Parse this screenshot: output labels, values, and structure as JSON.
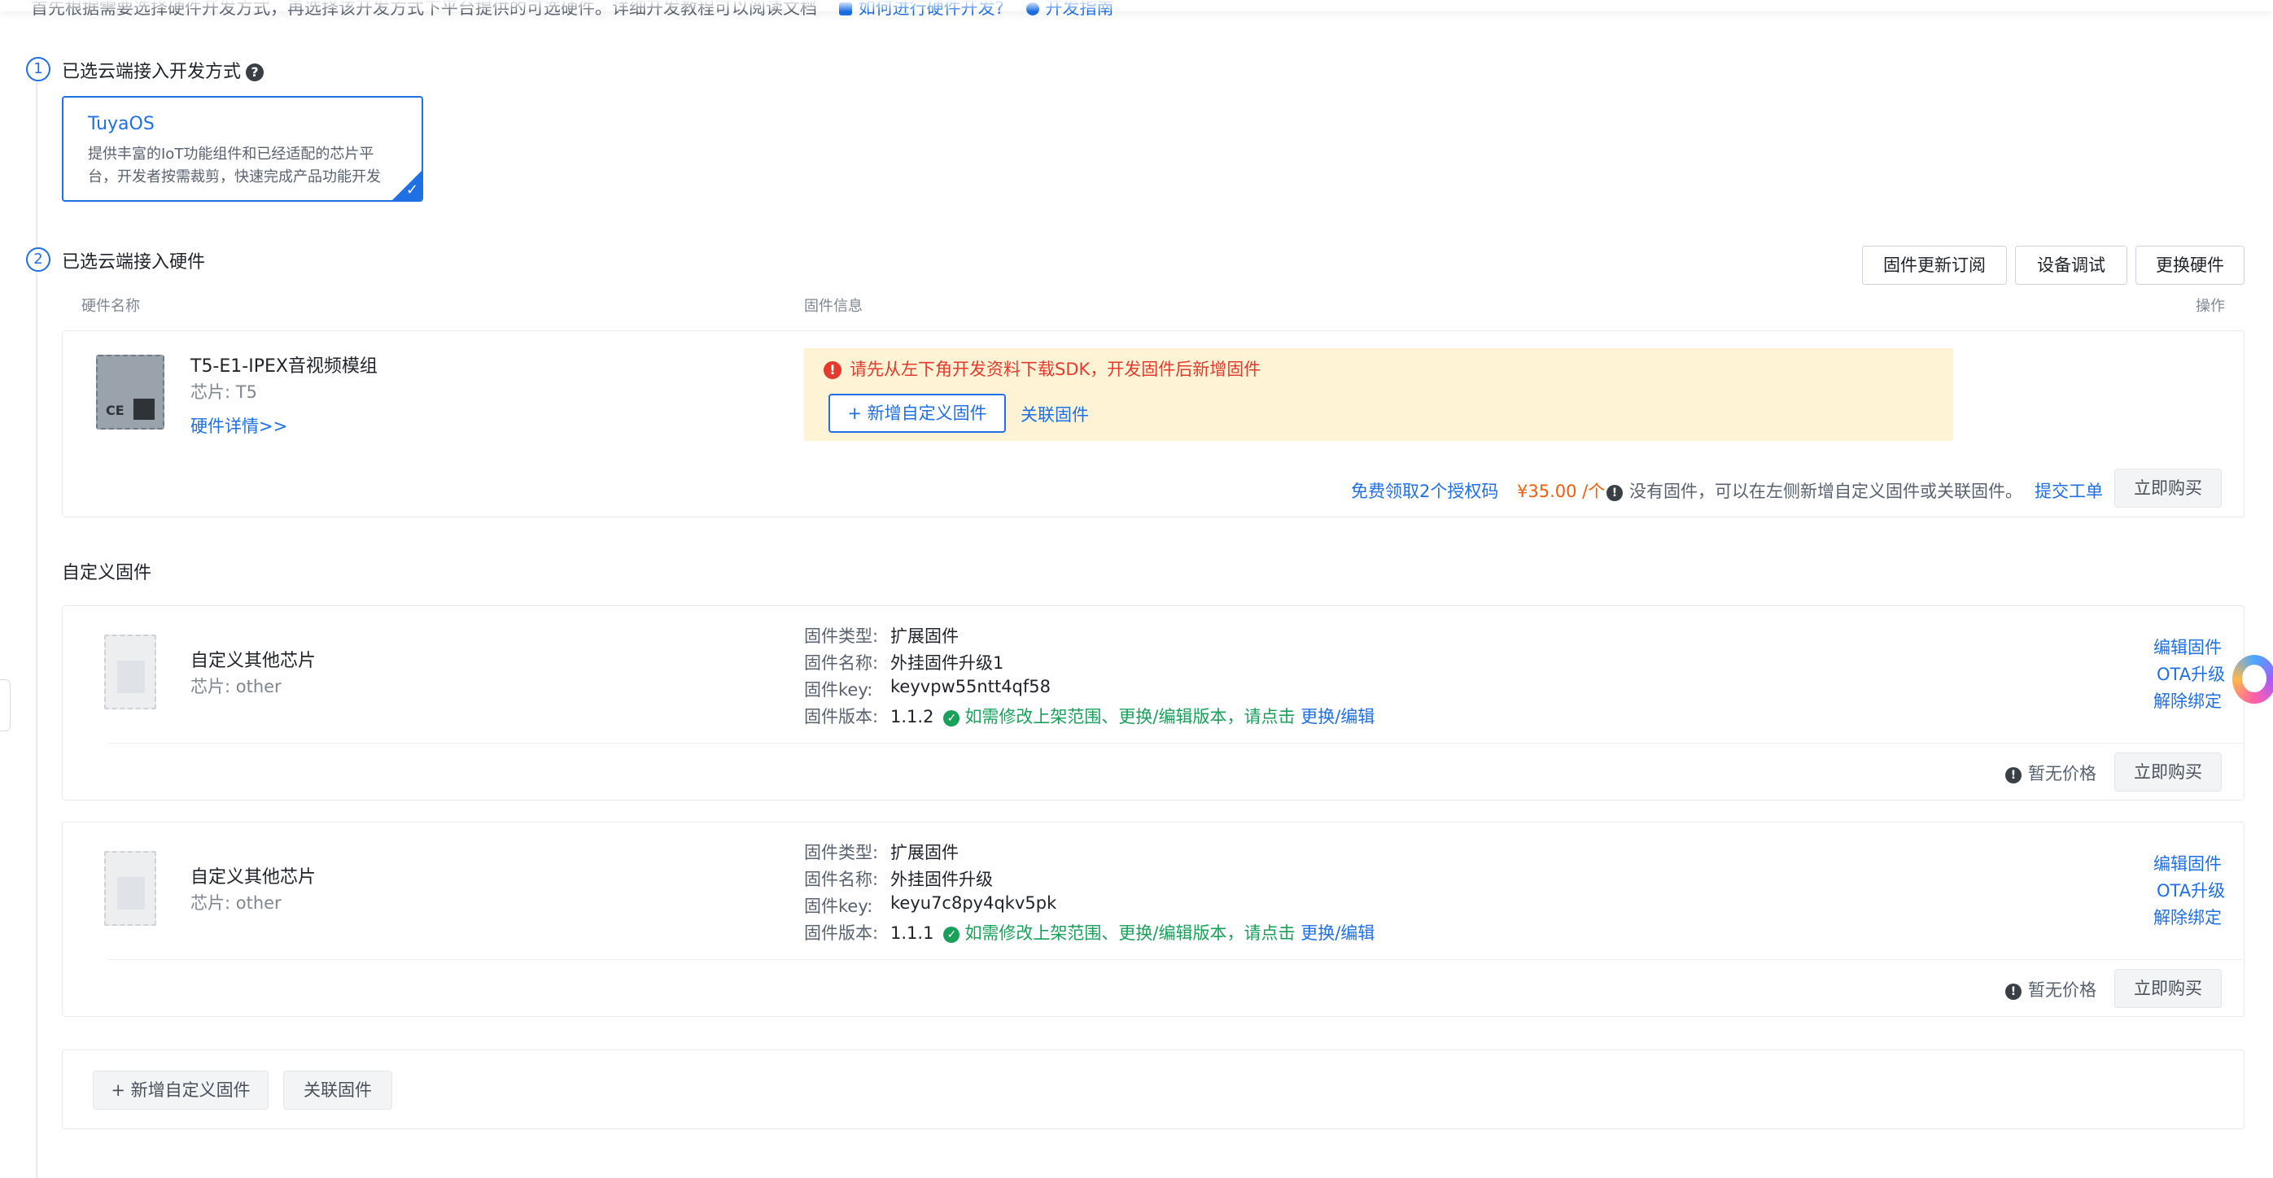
{
  "intro": {
    "text": "首先根据需要选择硬件开发方式，再选择该开发方式下平台提供的可选硬件。详细开发教程可以阅读文档",
    "link1": "如何进行硬件开发?",
    "link2": "开发指南"
  },
  "step1": {
    "num": "1",
    "title": "已选云端接入开发方式",
    "help": "?",
    "card": {
      "title": "TuyaOS",
      "desc": "提供丰富的IoT功能组件和已经适配的芯片平台，开发者按需裁剪，快速完成产品功能开发"
    }
  },
  "step2": {
    "num": "2",
    "title": "已选云端接入硬件",
    "buttons": [
      "固件更新订阅",
      "设备调试",
      "更换硬件"
    ],
    "columns": {
      "hw": "硬件名称",
      "fw": "固件信息",
      "op": "操作"
    }
  },
  "hardware": {
    "name": "T5-E1-IPEX音视频模组",
    "chip": "芯片: T5",
    "detail_link": "硬件详情>>",
    "warning": "请先从左下角开发资料下载SDK，开发固件后新增固件",
    "add_btn": "+ 新增自定义固件",
    "link_fw": "关联固件",
    "license_link": "免费领取2个授权码",
    "price": "¥35.00 /个",
    "note": "没有固件，可以在左侧新增自定义固件或关联固件。",
    "ticket_link": "提交工单",
    "buy_btn": "立即购买"
  },
  "custom_section_title": "自定义固件",
  "firmwares": [
    {
      "name": "自定义其他芯片",
      "chip": "芯片: other",
      "type_label": "固件类型:",
      "type": "扩展固件",
      "name_label": "固件名称:",
      "fw_name": "外挂固件升级1",
      "key_label": "固件key:",
      "key": "keyvpw55ntt4qf58",
      "version_label": "固件版本:",
      "version": "1.1.2",
      "version_note": "如需修改上架范围、更换/编辑版本，请点击",
      "version_link": "更换/编辑",
      "actions": [
        "编辑固件",
        "OTA升级",
        "解除绑定"
      ],
      "no_price": "暂无价格",
      "buy_btn": "立即购买"
    },
    {
      "name": "自定义其他芯片",
      "chip": "芯片: other",
      "type_label": "固件类型:",
      "type": "扩展固件",
      "name_label": "固件名称:",
      "fw_name": "外挂固件升级",
      "key_label": "固件key:",
      "key": "keyu7c8py4qkv5pk",
      "version_label": "固件版本:",
      "version": "1.1.1",
      "version_note": "如需修改上架范围、更换/编辑版本，请点击",
      "version_link": "更换/编辑",
      "actions": [
        "编辑固件",
        "OTA升级",
        "解除绑定"
      ],
      "no_price": "暂无价格",
      "buy_btn": "立即购买"
    }
  ],
  "bottom_buttons": {
    "add": "+ 新增自定义固件",
    "link": "关联固件"
  },
  "colors": {
    "accent": "#1f6fe5",
    "warning_bg": "#fff3d6",
    "error": "#e23b2e",
    "success": "#1aa05b",
    "price": "#f25e0a"
  }
}
